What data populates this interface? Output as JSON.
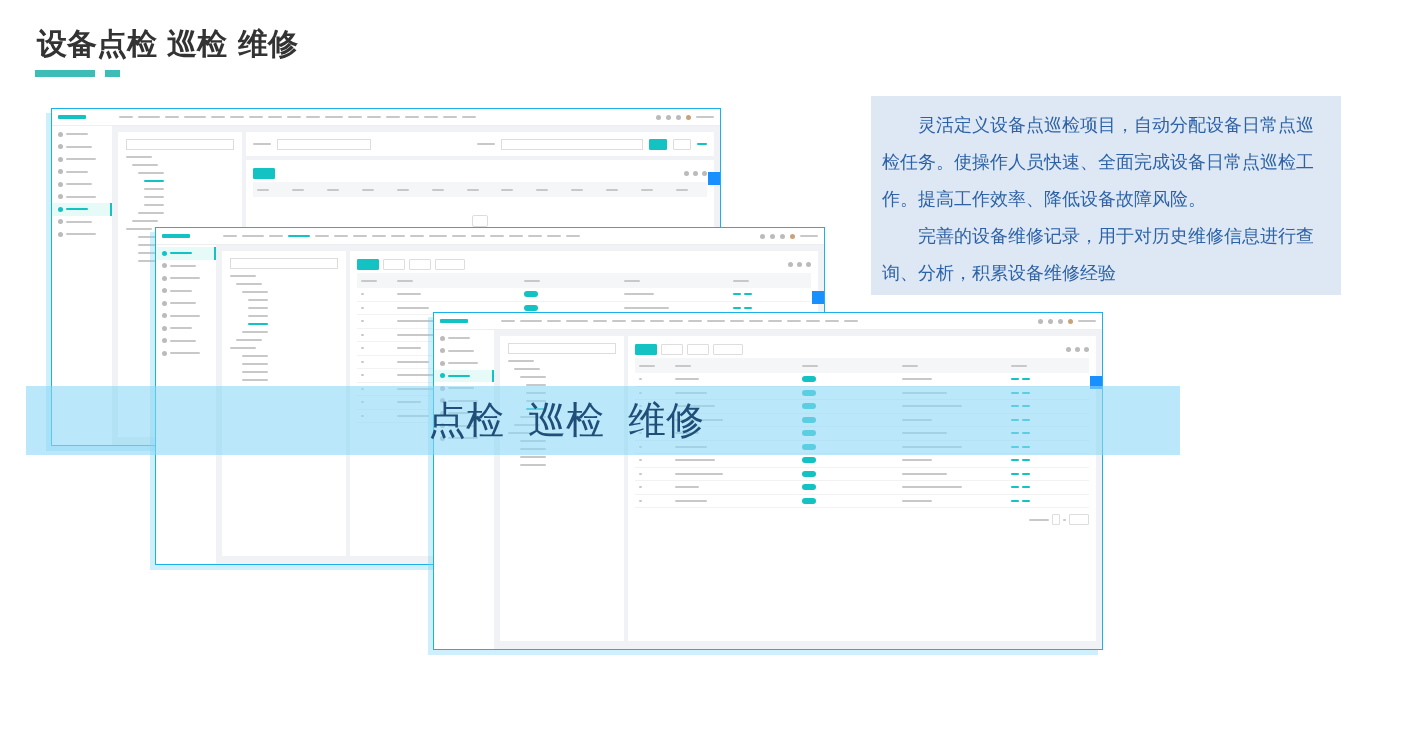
{
  "heading": {
    "title": "设备点检 巡检 维修"
  },
  "description": {
    "paragraphs": [
      "灵活定义设备点巡检项目，自动分配设备日常点巡检任务。使操作人员快速、全面完成设备日常点巡检工作。提高工作效率、降低设备故障风险。",
      "完善的设备维修记录，用于对历史维修信息进行查询、分析，积累设备维修经验"
    ]
  },
  "screenshots": [
    {
      "kind": "records"
    },
    {
      "kind": "items"
    },
    {
      "kind": "items"
    }
  ],
  "banner": {
    "text": "点检  巡检  维修"
  }
}
